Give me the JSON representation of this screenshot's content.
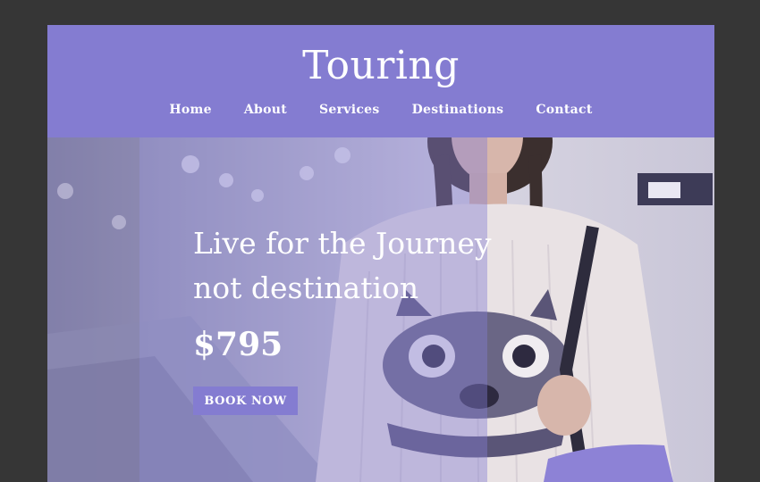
{
  "header": {
    "brand": "Touring",
    "nav": [
      "Home",
      "About",
      "Services",
      "Destinations",
      "Contact"
    ]
  },
  "hero": {
    "headline_line1": "Live for the Journey",
    "headline_line2": "not destination",
    "price": "$795",
    "cta_label": "BOOK NOW"
  },
  "colors": {
    "accent": "#847cd1",
    "frame": "#363636",
    "text": "#ffffff"
  }
}
